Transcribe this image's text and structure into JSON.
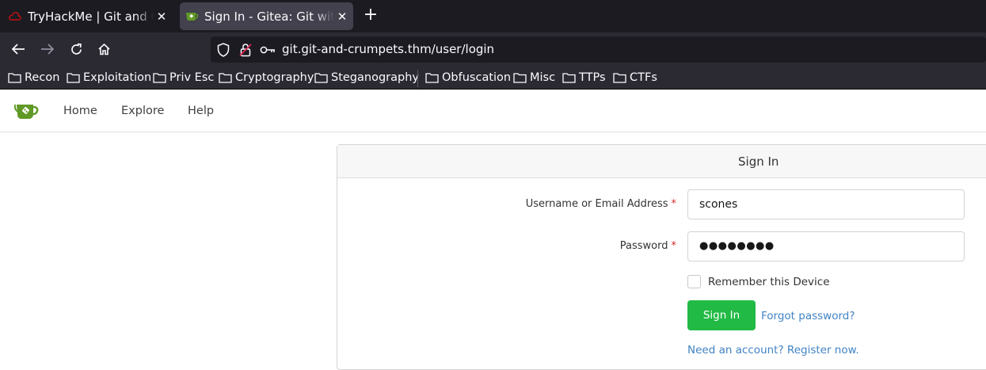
{
  "browser": {
    "tabs": [
      {
        "title": "TryHackMe | Git and Crumpets",
        "active": false,
        "icon": "tryhackme-cloud-icon"
      },
      {
        "title": "Sign In - Gitea: Git with a cup of tea",
        "active": true,
        "icon": "gitea-icon"
      }
    ],
    "url": "git.git-and-crumpets.thm/user/login",
    "bookmarks": [
      "Recon",
      "Exploitation",
      "Priv Esc",
      "Cryptography",
      "Steganography",
      "Obfuscation",
      "Misc",
      "TTPs",
      "CTFs"
    ]
  },
  "gitea": {
    "nav": {
      "home": "Home",
      "explore": "Explore",
      "help": "Help"
    },
    "signin": {
      "header": "Sign In",
      "username_label": "Username or Email Address",
      "username_value": "scones",
      "password_label": "Password",
      "password_value": "●●●●●●●●",
      "required_marker": "*",
      "remember_label": "Remember this Device",
      "remember_checked": false,
      "submit_label": "Sign In",
      "forgot_label": "Forgot password?",
      "register_label": "Need an account? Register now."
    }
  },
  "colors": {
    "accent_green": "#21ba45",
    "link_blue": "#4183c4",
    "required_red": "#db2828",
    "gitea_green": "#609926"
  }
}
